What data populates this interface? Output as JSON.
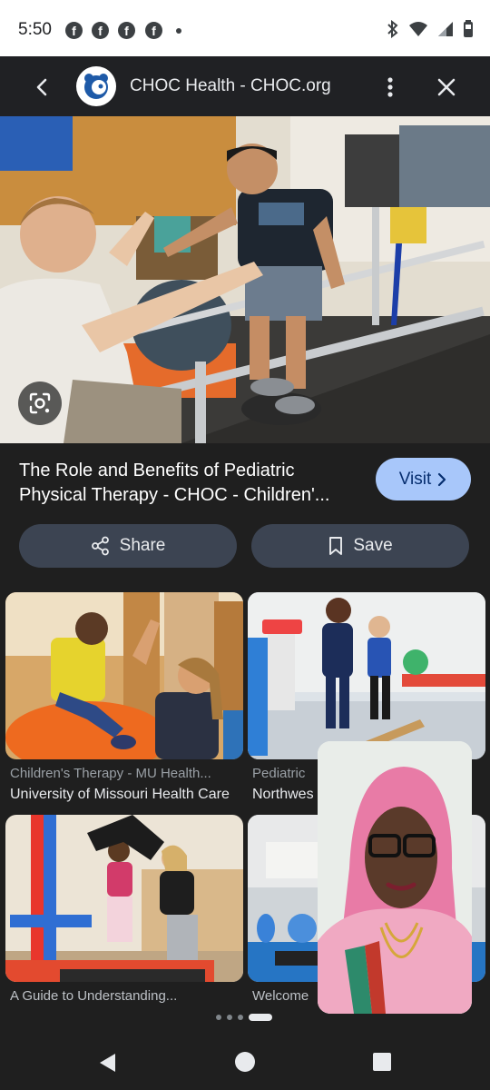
{
  "status_bar": {
    "time": "5:50",
    "fb_glyph": "f"
  },
  "header": {
    "title": "CHOC Health - CHOC.org",
    "logo_icon": "choc-bear-logo"
  },
  "result": {
    "title": "The Role and Benefits of Pediatric Physical Therapy - CHOC - Children'...",
    "visit_label": "Visit"
  },
  "actions": {
    "share_label": "Share",
    "save_label": "Save"
  },
  "related": [
    {
      "source": "Children's Therapy - MU Health...",
      "title": "University of Missouri Health Care"
    },
    {
      "source": "Pediatric",
      "title": "Northwes"
    },
    {
      "source": "",
      "title": "A Guide to Understanding..."
    },
    {
      "source": "",
      "title": "Welcome"
    }
  ],
  "pager": {
    "pages": 4,
    "active": 4
  },
  "colors": {
    "accent": "#a8c7fa",
    "pill_bg": "#3c4452",
    "bg": "#1f1f1f"
  }
}
